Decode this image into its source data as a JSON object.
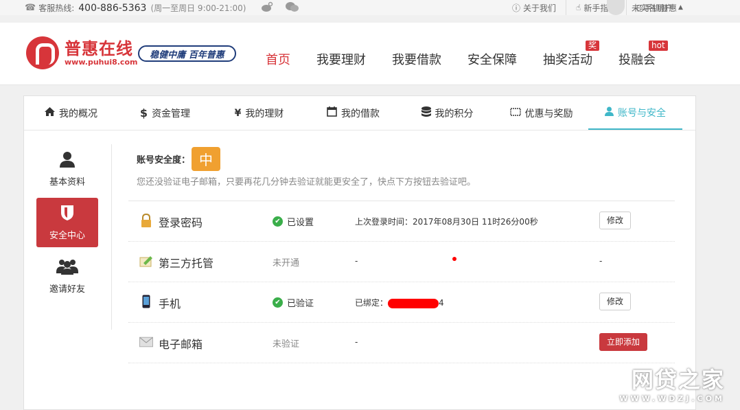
{
  "topbar": {
    "hotline_label": "客服热线:",
    "hotline_number": "400-886-5363",
    "hotline_hours": "(周一至周日 9:00-21:00)",
    "links": [
      "关于我们",
      "新手指引",
      "手机普惠"
    ],
    "username": "未实名用户"
  },
  "header": {
    "brand_name": "普惠在线",
    "brand_url": "www.puhui8.com",
    "slogan": "稳健中庸 百年普惠",
    "nav": [
      {
        "label": "首页",
        "active": true,
        "badge": ""
      },
      {
        "label": "我要理财",
        "active": false,
        "badge": ""
      },
      {
        "label": "我要借款",
        "active": false,
        "badge": ""
      },
      {
        "label": "安全保障",
        "active": false,
        "badge": ""
      },
      {
        "label": "抽奖活动",
        "active": false,
        "badge": "奖"
      },
      {
        "label": "投融会",
        "active": false,
        "badge": "hot"
      }
    ]
  },
  "tabs": [
    {
      "icon": "home-icon",
      "label": "我的概况"
    },
    {
      "icon": "dollar-icon",
      "label": "资金管理"
    },
    {
      "icon": "yen-icon",
      "label": "我的理财"
    },
    {
      "icon": "calendar-icon",
      "label": "我的借款"
    },
    {
      "icon": "database-icon",
      "label": "我的积分"
    },
    {
      "icon": "ticket-icon",
      "label": "优惠与奖励"
    },
    {
      "icon": "user-icon",
      "label": "账号与安全"
    }
  ],
  "active_tab": "账号与安全",
  "sidebar": [
    {
      "icon": "user-icon",
      "label": "基本资料"
    },
    {
      "icon": "shield-icon",
      "label": "安全中心"
    },
    {
      "icon": "users-icon",
      "label": "邀请好友"
    }
  ],
  "security": {
    "level_label": "账号安全度：",
    "level_value": "中",
    "hint": "您还没验证电子邮箱，只要再花几分钟去验证就能更安全了，快点下方按钮去验证吧。"
  },
  "rows": [
    {
      "icon": "lock-icon",
      "name": "登录密码",
      "status": "已设置",
      "verified": true,
      "detail": "上次登录时间：2017年08月30日 11时26分00秒",
      "action": "修改"
    },
    {
      "icon": "escrow-icon",
      "name": "第三方托管",
      "status": "未开通",
      "verified": false,
      "detail": "-",
      "action": "-"
    },
    {
      "icon": "phone-icon",
      "name": "手机",
      "status": "已验证",
      "verified": true,
      "detail_prefix": "已绑定：",
      "detail_suffix": "4",
      "action": "修改"
    },
    {
      "icon": "mail-icon",
      "name": "电子邮箱",
      "status": "未验证",
      "verified": false,
      "detail": "-",
      "action": "立即添加"
    }
  ],
  "watermark": {
    "line1": "网贷之家",
    "line2": "WWW.WDZJ.COM"
  },
  "colors": {
    "brand_red": "#d7353a",
    "tab_active": "#3fb7c8",
    "level_orange": "#f0a030",
    "ok_green": "#3aae4a"
  }
}
